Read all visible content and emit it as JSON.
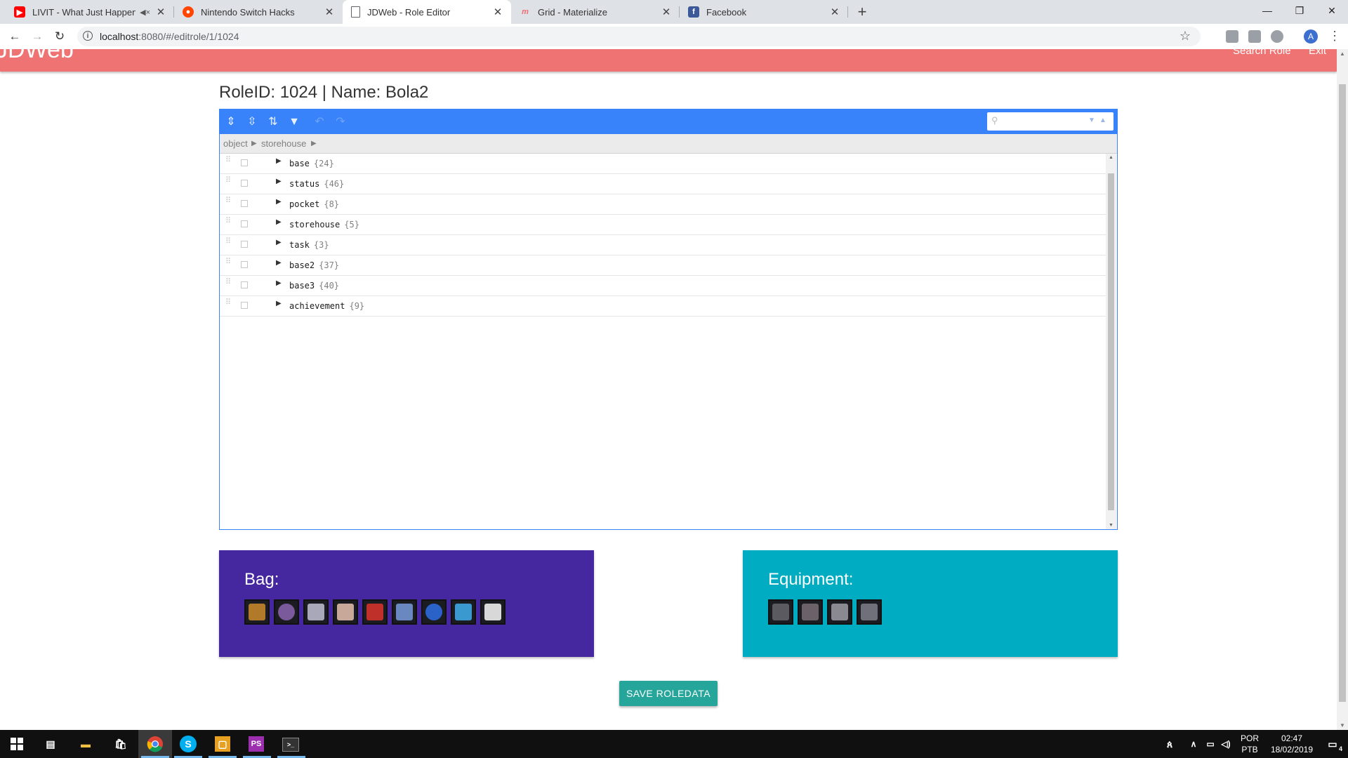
{
  "browser": {
    "tabs": [
      {
        "title": "LIVIT - What Just Happened",
        "favicon": "youtube-icon",
        "color": "#ff0000",
        "audio": true,
        "active": false
      },
      {
        "title": "Nintendo Switch Hacks",
        "favicon": "reddit-icon",
        "color": "#ff4500",
        "active": false
      },
      {
        "title": "JDWeb - Role Editor",
        "favicon": "page-icon",
        "color": "#5f6368",
        "active": true
      },
      {
        "title": "Grid - Materialize",
        "favicon": "materialize-icon",
        "color": "#ee6e73",
        "active": false
      },
      {
        "title": "Facebook",
        "favicon": "facebook-icon",
        "color": "#3b5998",
        "active": false
      }
    ],
    "url_host": "localhost",
    "url_rest": ":8080/#/editrole/1/1024",
    "profile_initial": "A"
  },
  "app": {
    "brand": "JDWeb",
    "nav_links": [
      "Search Role",
      "Exit"
    ],
    "header_color": "#ef7373"
  },
  "page": {
    "title": "RoleID: 1024 | Name: Bola2"
  },
  "editor": {
    "accent": "#3883fa",
    "breadcrumb": [
      "object",
      "storehouse"
    ],
    "search_value": "",
    "rows": [
      {
        "field": "base",
        "count": "{24}"
      },
      {
        "field": "status",
        "count": "{46}"
      },
      {
        "field": "pocket",
        "count": "{8}"
      },
      {
        "field": "storehouse",
        "count": "{5}"
      },
      {
        "field": "task",
        "count": "{3}"
      },
      {
        "field": "base2",
        "count": "{37}"
      },
      {
        "field": "base3",
        "count": "{40}"
      },
      {
        "field": "achievement",
        "count": "{9}"
      }
    ]
  },
  "bag": {
    "title": "Bag:",
    "color": "#4527a0",
    "items": [
      "item-icon",
      "item-icon",
      "item-icon",
      "item-icon",
      "item-icon",
      "item-icon",
      "item-icon",
      "item-icon",
      "item-icon"
    ]
  },
  "equipment": {
    "title": "Equipment:",
    "color": "#00acc1",
    "items": [
      "item-icon",
      "item-icon",
      "item-icon",
      "item-icon"
    ]
  },
  "actions": {
    "save_label": "SAVE ROLEDATA",
    "save_color": "#26a69a"
  },
  "taskbar": {
    "language": "POR",
    "layout": "PTB",
    "time": "02:47",
    "date": "18/02/2019",
    "notifications": "4"
  }
}
